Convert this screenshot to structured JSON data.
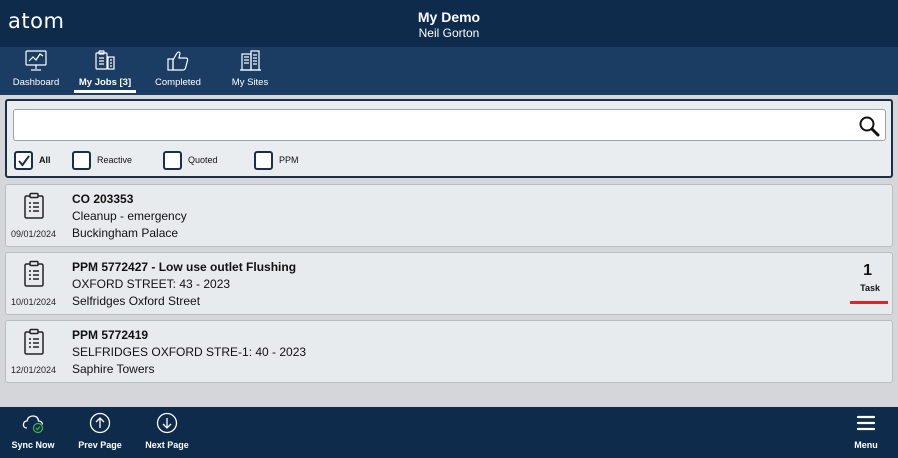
{
  "header": {
    "logo": "atom",
    "title": "My Demo",
    "subtitle": "Neil Gorton"
  },
  "nav": {
    "tabs": [
      {
        "label": "Dashboard",
        "icon": "monitor-chart-icon",
        "active": false
      },
      {
        "label": "My Jobs [3]",
        "icon": "clipboard-building-icon",
        "active": true
      },
      {
        "label": "Completed",
        "icon": "thumbs-up-icon",
        "active": false
      },
      {
        "label": "My Sites",
        "icon": "buildings-icon",
        "active": false
      }
    ]
  },
  "filter": {
    "search_value": "",
    "search_placeholder": "",
    "checkboxes": [
      {
        "label": "All",
        "checked": true
      },
      {
        "label": "Reactive",
        "checked": false
      },
      {
        "label": "Quoted",
        "checked": false
      },
      {
        "label": "PPM",
        "checked": false
      }
    ]
  },
  "jobs": [
    {
      "ref": "CO 203353",
      "line2": "Cleanup - emergency",
      "line3": "Buckingham Palace",
      "date": "09/01/2024"
    },
    {
      "ref": "PPM 5772427 - Low use outlet Flushing",
      "line2": "OXFORD STREET: 43 - 2023",
      "line3": "Selfridges Oxford Street",
      "date": "10/01/2024",
      "task_count": "1",
      "task_label": "Task"
    },
    {
      "ref": "PPM 5772419",
      "line2": "SELFRIDGES OXFORD STRE-1: 40 - 2023",
      "line3": "Saphire Towers",
      "date": "12/01/2024"
    }
  ],
  "footer": {
    "sync_label": "Sync Now",
    "prev_label": "Prev Page",
    "next_label": "Next Page",
    "menu_label": "Menu"
  },
  "colors": {
    "header_bg": "#0e2b4b",
    "nav_bg": "#1b3d63",
    "task_bar": "#d8262f",
    "sync_ok": "#3db04a"
  }
}
